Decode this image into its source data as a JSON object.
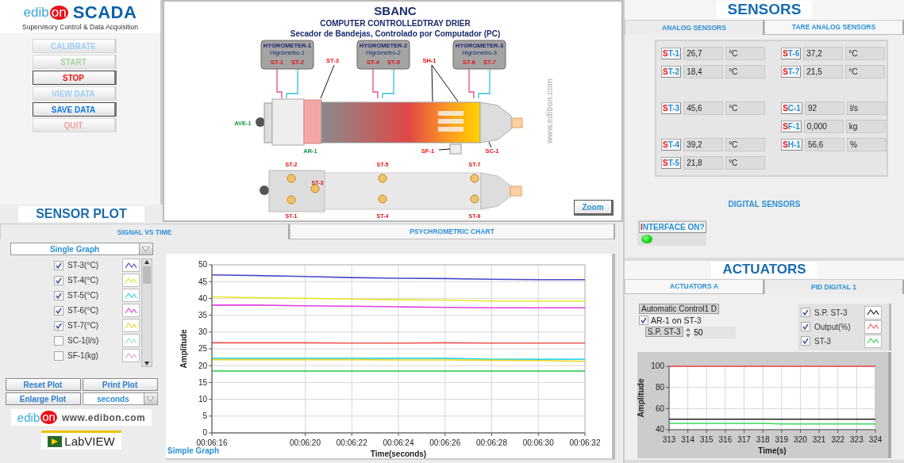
{
  "logo": {
    "brand_start": "edib",
    "brand_end": "on",
    "product": "SCADA",
    "tagline": "Supervisory Control & Data Acquisition"
  },
  "control_buttons": [
    {
      "label": "CALIBRATE",
      "disabled": true,
      "color": "#9fcdf5"
    },
    {
      "label": "START",
      "disabled": true,
      "color": "#a3d3a0"
    },
    {
      "label": "STOP",
      "disabled": false,
      "color": "#ee1111"
    },
    {
      "label": "VIEW DATA",
      "disabled": true,
      "color": "#9fcdf5"
    },
    {
      "label": "SAVE DATA",
      "disabled": false,
      "color": "#1177dd"
    },
    {
      "label": "QUIT",
      "disabled": true,
      "color": "#f4a0a0"
    }
  ],
  "diagram": {
    "title": "SBANC",
    "subtitle": "COMPUTER CONTROLLEDTRAY DRIER",
    "subtitle_es": "Secador de Bandejas, Controlado por Computador (PC)",
    "hygrometers": [
      {
        "name": "HYGROMETER-1",
        "name_es": "Higrómetro-1",
        "sensors": [
          "ST-1",
          "ST-2"
        ]
      },
      {
        "name": "HYGROMETER-2",
        "name_es": "Higrómetro-2",
        "sensors": [
          "ST-4",
          "ST-5"
        ]
      },
      {
        "name": "HYGROMETER-3",
        "name_es": "Higrómetro-3",
        "sensors": [
          "ST-6",
          "ST-7"
        ]
      }
    ],
    "side_labels": [
      {
        "text": "ST-3",
        "kind": "sensor"
      },
      {
        "text": "SH-1",
        "kind": "sensor"
      },
      {
        "text": "AVE-1",
        "kind": "actuator"
      },
      {
        "text": "AR-1",
        "kind": "actuator"
      },
      {
        "text": "SF-1",
        "kind": "sensor"
      },
      {
        "text": "SC-1",
        "kind": "sensor"
      }
    ],
    "top_view_labels": [
      "ST-2",
      "ST-5",
      "ST-7",
      "ST-3",
      "ST-1",
      "ST-4",
      "ST-6"
    ],
    "website": "www.edibon.com",
    "zoom_button": "Zoom"
  },
  "sensor_plot": {
    "title": "SENSOR PLOT",
    "tabs": [
      {
        "label": "SIGNAL VS TIME",
        "selected": true
      },
      {
        "label": "PSYCHROMETRIC CHART",
        "selected": false
      }
    ],
    "mode": "Single Graph",
    "legend": [
      {
        "label": "ST-3(°C)",
        "checked": true,
        "color": "#4b4bc8"
      },
      {
        "label": "ST-4(°C)",
        "checked": true,
        "color": "#e8e830"
      },
      {
        "label": "ST-5(°C)",
        "checked": true,
        "color": "#30d8e8"
      },
      {
        "label": "ST-6(°C)",
        "checked": true,
        "color": "#e040e0"
      },
      {
        "label": "ST-7(°C)",
        "checked": true,
        "color": "#f0d020"
      },
      {
        "label": "SC-1(l/s)",
        "checked": false,
        "color": "#90e0d8"
      },
      {
        "label": "SF-1(kg)",
        "checked": false,
        "color": "#e0a0d8"
      }
    ],
    "buttons": [
      "Reset Plot",
      "Print Plot",
      "Enlarge Plot"
    ],
    "time_unit": "seconds",
    "graph_caption": "Simple Graph",
    "chart_data": {
      "type": "line",
      "grid": true,
      "xlabel": "Time(seconds)",
      "ylabel": "Amplitude",
      "categories": [
        "00:06:16",
        null,
        "00:06:20",
        "00:06:22",
        "00:06:24",
        "00:06:26",
        "00:06:28",
        "00:06:30",
        "00:06:32"
      ],
      "ylim": [
        0,
        50
      ],
      "yticks": [
        0,
        5,
        10,
        15,
        20,
        25,
        30,
        35,
        40,
        45,
        50
      ],
      "series": [
        {
          "color": "#4b4bc8",
          "values": [
            47,
            46.8,
            46.5,
            46.2,
            46,
            45.9,
            45.7,
            45.6,
            45.6
          ]
        },
        {
          "color": "#e8e830",
          "values": [
            40.5,
            40.2,
            40,
            39.8,
            39.6,
            39.5,
            39.2,
            39.2,
            39.2
          ]
        },
        {
          "color": "#30d8e8",
          "values": [
            22.2,
            22.2,
            22.2,
            22.2,
            22.2,
            22.2,
            21.9,
            21.9,
            21.9
          ]
        },
        {
          "color": "#e040e0",
          "values": [
            38,
            38,
            37.8,
            37.7,
            37.5,
            37.3,
            37.2,
            37.2,
            37.2
          ]
        },
        {
          "color": "#f0d020",
          "values": [
            21.8,
            21.8,
            21.8,
            21.8,
            21.7,
            21.7,
            21.6,
            21.5,
            21.3
          ]
        },
        {
          "color": "#ee5555",
          "values": [
            26.8,
            26.8,
            26.8,
            26.7,
            26.7,
            26.8,
            26.7,
            26.7,
            26.7
          ]
        },
        {
          "color": "#22cc44",
          "values": [
            18.4,
            18.4,
            18.4,
            18.4,
            18.4,
            18.4,
            18.4,
            18.4,
            18.4
          ]
        }
      ]
    }
  },
  "footer_logos": {
    "brand_start": "edib",
    "brand_end": "on",
    "website": "www.edibon.com",
    "labview": "LabVIEW"
  },
  "sensors": {
    "title": "SENSORS",
    "tabs": [
      {
        "label": "ANALOG SENSORS",
        "selected": true
      },
      {
        "label": "TARE ANALOG SENSORS",
        "selected": false
      }
    ],
    "analog_left": [
      {
        "tag": "ST-1",
        "value": "26,7",
        "unit": "°C"
      },
      {
        "tag": "ST-2",
        "value": "18,4",
        "unit": "°C"
      },
      {
        "tag": "ST-3",
        "value": "45,6",
        "unit": "°C"
      },
      {
        "tag": "ST-4",
        "value": "39,2",
        "unit": "°C"
      },
      {
        "tag": "ST-5",
        "value": "21,8",
        "unit": "°C"
      }
    ],
    "analog_right": [
      {
        "tag": "ST-6",
        "value": "37,2",
        "unit": "°C"
      },
      {
        "tag": "ST-7",
        "value": "21,5",
        "unit": "°C"
      },
      {
        "tag": "SC-1",
        "value": "92",
        "unit": "l/s"
      },
      {
        "tag": "SF-1",
        "value": "0,000",
        "unit": "kg"
      },
      {
        "tag": "SH-1",
        "value": "56,6",
        "unit": "%"
      }
    ],
    "digital_title": "DIGITAL SENSORS",
    "interface": {
      "label": "INTERFACE ON?",
      "on": true
    }
  },
  "actuators": {
    "title": "ACTUATORS",
    "tabs": [
      {
        "label": "ACTUATORS A",
        "selected": false
      },
      {
        "label": "PID DIGITAL 1",
        "selected": true
      }
    ],
    "mode_label": "Automatic Control1 D",
    "ar_control": {
      "label": "AR-1 on ST-3",
      "checked": true
    },
    "setpoint": {
      "label": "S.P. ST-3",
      "value": "50"
    },
    "legend": [
      {
        "label": "S.P. ST-3",
        "checked": true,
        "color": "#222222"
      },
      {
        "label": "Output(%)",
        "checked": true,
        "color": "#ee6666"
      },
      {
        "label": "ST-3",
        "checked": true,
        "color": "#33dd55"
      }
    ],
    "chart_data": {
      "type": "line",
      "grid": true,
      "xlabel": "Time(s)",
      "ylabel": "Amplitude",
      "x": [
        313,
        314,
        315,
        316,
        317,
        318,
        319,
        320,
        321,
        322,
        323,
        324
      ],
      "xlim": [
        313,
        324
      ],
      "ylim": [
        40,
        100
      ],
      "xticks": [
        313,
        314,
        315,
        316,
        317,
        318,
        319,
        320,
        321,
        322,
        323,
        324
      ],
      "yticks": [
        40,
        60,
        80,
        100
      ],
      "series": [
        {
          "color": "#222222",
          "values": [
            50,
            50,
            50,
            50,
            50,
            50,
            50,
            50,
            50,
            50,
            50,
            50
          ]
        },
        {
          "color": "#ee4444",
          "values": [
            100,
            100,
            100,
            100,
            100,
            100,
            100,
            100,
            100,
            100,
            100,
            100
          ]
        },
        {
          "color": "#33dd55",
          "values": [
            46,
            46,
            46,
            46,
            46,
            46,
            45.5,
            45.5,
            45.5,
            45.5,
            45.5,
            45.5
          ]
        }
      ]
    }
  }
}
